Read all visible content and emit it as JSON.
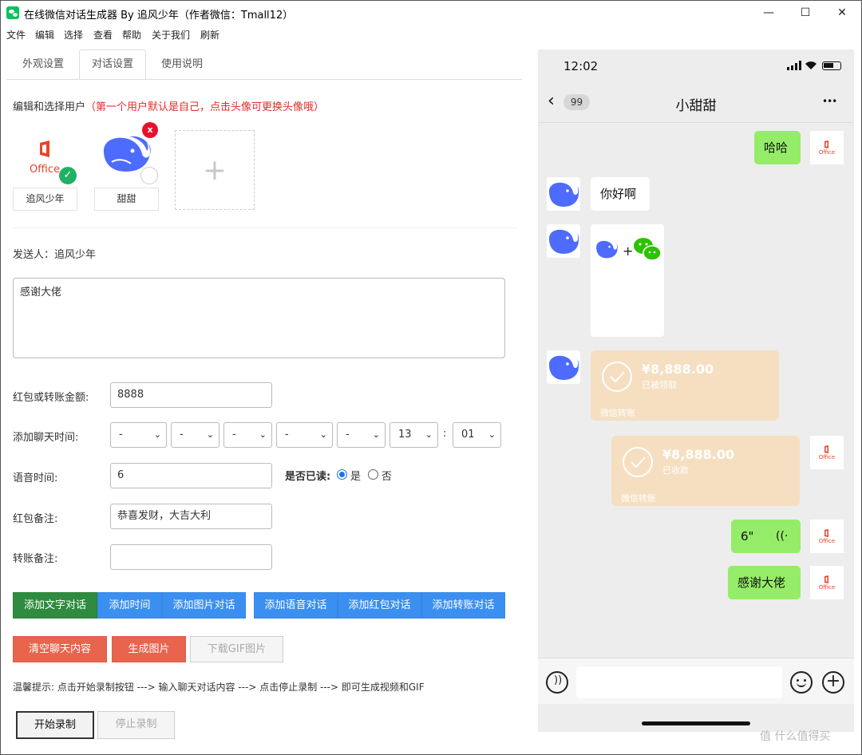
{
  "window": {
    "title": "在线微信对话生成器 By 追风少年（作者微信：Tmall12）",
    "minimize": "—",
    "maximize": "☐",
    "close": "✕"
  },
  "menu": [
    "文件",
    "编辑",
    "选择",
    "查看",
    "帮助",
    "关于我们",
    "刷新"
  ],
  "tabs": [
    "外观设置",
    "对话设置",
    "使用说明"
  ],
  "users_hint": {
    "label": "编辑和选择用户",
    "note": "（第一个用户默认是自己，点击头像可更换头像哦）"
  },
  "users": [
    {
      "name": "追风少年",
      "logo_text": "Office",
      "selected": true
    },
    {
      "name": "甜甜",
      "delete": "x",
      "selected": false
    }
  ],
  "add_user_glyph": "+",
  "sender": "发送人：追风少年",
  "message_text": "感谢大佬",
  "form": {
    "amount_label": "红包或转账金额:",
    "amount_value": "8888",
    "time_label": "添加聊天时间:",
    "time_selects": [
      "-",
      "-",
      "-",
      "-",
      "-",
      "13",
      "01"
    ],
    "time_colon": ":",
    "voice_label": "语音时间:",
    "voice_value": "6",
    "read_label": "是否已读:",
    "read_yes": "是",
    "read_no": "否",
    "redpacket_note_label": "红包备注:",
    "redpacket_note_value": "恭喜发财，大吉大利",
    "transfer_note_label": "转账备注:",
    "transfer_note_value": ""
  },
  "buttons": {
    "add_text": "添加文字对话",
    "add_time": "添加时间",
    "add_image": "添加图片对话",
    "add_voice": "添加语音对话",
    "add_redpacket": "添加红包对话",
    "add_transfer": "添加转账对话",
    "clear": "清空聊天内容",
    "gen_image": "生成图片",
    "download_gif": "下载GIF图片",
    "start_rec": "开始录制",
    "stop_rec": "停止录制"
  },
  "tip": "温馨提示: 点击开始录制按钮 ---> 输入聊天对话内容 ---> 点击停止录制 ---> 即可生成视频和GIF",
  "phone": {
    "time": "12:02",
    "back_count": "99",
    "chat_title": "小甜甜",
    "more": "•••",
    "messages": [
      {
        "side": "right",
        "type": "text",
        "text": "哈哈"
      },
      {
        "side": "left",
        "type": "text",
        "text": "你好啊"
      },
      {
        "side": "left",
        "type": "image",
        "plus": "+"
      },
      {
        "side": "left",
        "type": "transfer",
        "amount": "¥8,888.00",
        "status": "已被领取",
        "footer": "微信转账"
      },
      {
        "side": "right",
        "type": "transfer",
        "amount": "¥8,888.00",
        "status": "已收款",
        "footer": "微信转账"
      },
      {
        "side": "right",
        "type": "voice",
        "text": "6\""
      },
      {
        "side": "right",
        "type": "text",
        "text": "感谢大佬"
      }
    ],
    "office_small": "Office"
  },
  "watermark": "值 什么值得买",
  "colors": {
    "bubble_green": "#95ec69",
    "transfer_bg": "#f5dfc0",
    "btn_green": "#2e8b3f",
    "btn_blue": "#3b8ff0",
    "btn_red": "#e8644c",
    "hint_red": "#e52c2c"
  }
}
